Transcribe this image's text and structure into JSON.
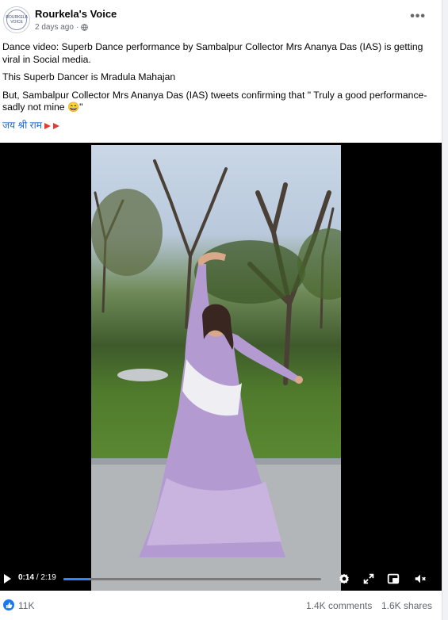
{
  "post": {
    "page_name": "Rourkela's Voice",
    "avatar_text": "ROURKELA VOICE",
    "time_ago": "2 days ago",
    "separator": "·",
    "more_label": "•••",
    "paragraphs": [
      "Dance video: Superb Dance performance by Sambalpur Collector Mrs Ananya Das (IAS) is getting viral in Social media.",
      "This Superb Dancer is Mradula Mahajan",
      "But, Sambalpur Collector Mrs Ananya Das (IAS) tweets confirming that \" Truly a good performance- sadly not mine 😄\""
    ],
    "hashtag": "जय श्री राम"
  },
  "video": {
    "current_time": "0:14",
    "duration": "2:19",
    "time_sep": " / ",
    "progress": 0.1,
    "icons": [
      "play-icon",
      "settings-icon",
      "fullscreen-icon",
      "picture-in-picture-icon",
      "mute-icon"
    ]
  },
  "stats": {
    "likes": "11K",
    "comments": "1.4K comments",
    "shares": "1.6K shares"
  },
  "colors": {
    "link_blue": "#216fdb",
    "like_blue": "#1877f2",
    "progress_blue": "#2d88ff"
  }
}
